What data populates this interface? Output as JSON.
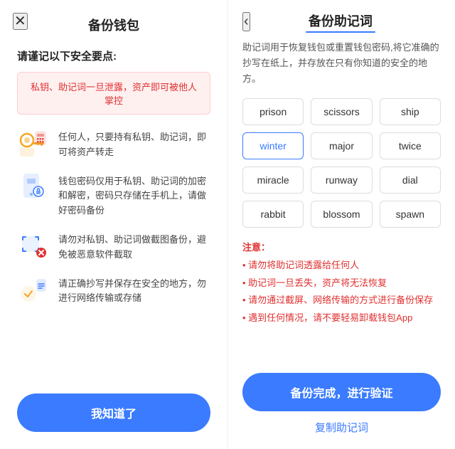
{
  "left": {
    "close_icon": "✕",
    "title": "备份钱包",
    "subtitle": "请谨记以下安全要点:",
    "warning": "私钥、助记词一旦泄露，资产即可被他人掌控",
    "security_items": [
      {
        "icon_name": "key-icon",
        "text": "任何人，只要持有私钥、助记词，即可将资产转走"
      },
      {
        "icon_name": "phone-lock-icon",
        "text": "钱包密码仅用于私钥、助记词的加密和解密，密码只存储在手机上，请做好密码备份"
      },
      {
        "icon_name": "screenshot-x-icon",
        "text": "请勿对私钥、助记词做截图备份，避免被恶意软件截取"
      },
      {
        "icon_name": "copy-safe-icon",
        "text": "请正确抄写并保存在安全的地方，勿进行网络传输或存储"
      }
    ],
    "confirm_btn": "我知道了"
  },
  "right": {
    "back_icon": "‹",
    "title": "备份助记词",
    "description": "助记词用于恢复钱包或重置钱包密码,将它准确的抄写在纸上，并存放在只有你知道的安全的地方。",
    "words": [
      "prison",
      "scissors",
      "ship",
      "winter",
      "major",
      "twice",
      "miracle",
      "runway",
      "dial",
      "rabbit",
      "blossom",
      "spawn"
    ],
    "highlighted_word": "winter",
    "notes_title": "注意：",
    "notes": [
      "请勿将助记词透露给任何人",
      "助记词一旦丢失，资产将无法恢复",
      "请勿通过截屏、网络传输的方式进行备份保存",
      "遇到任何情况，请不要轻易卸载钱包App"
    ],
    "primary_btn": "备份完成，进行验证",
    "secondary_btn": "复制助记词"
  }
}
